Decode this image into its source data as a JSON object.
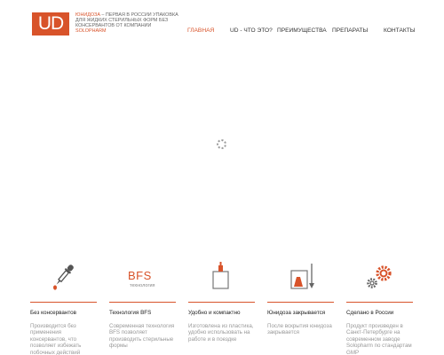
{
  "header": {
    "logo_text": "UD",
    "tagline_accent": "Юнидоза",
    "tagline_rest": " – первая в России упаковка для жидких стерильных форм без консервантов от компании ",
    "tagline_brand": "Solopharm"
  },
  "nav": {
    "items": [
      {
        "label": "ГЛАВНАЯ",
        "active": true
      },
      {
        "label": "UD - ЧТО ЭТО?",
        "active": false
      },
      {
        "label": "ПРЕИМУЩЕСТВА",
        "active": false
      },
      {
        "label": "ПРЕПАРАТЫ",
        "active": false
      },
      {
        "label": "КОНТАКТЫ",
        "active": false
      }
    ]
  },
  "colors": {
    "accent": "#d8532a",
    "text": "#444444",
    "muted": "#999999"
  },
  "features": [
    {
      "icon": "dropper-icon",
      "title": "Без консервантов",
      "desc": "Производится без применения консервантов, что позволяет избежать побочных действий"
    },
    {
      "icon": "bfs-icon",
      "icon_text": "BFS",
      "icon_sub": "технология",
      "title": "Технология BFS",
      "desc": "Современная технология BFS позволяет производить стерильные формы"
    },
    {
      "icon": "container-icon",
      "title": "Удобно и компактно",
      "desc": "Изготовлена из пластика, удобно использовать на работе и в поездке"
    },
    {
      "icon": "closing-icon",
      "title": "Юнидоза закрывается",
      "desc": "После вскрытия юнидоза закрывается"
    },
    {
      "icon": "gears-icon",
      "title": "Сделано в России",
      "desc": "Продукт произведен в Санкт-Петербурге на современном заводе Solopharm по стандартам GMP"
    }
  ]
}
